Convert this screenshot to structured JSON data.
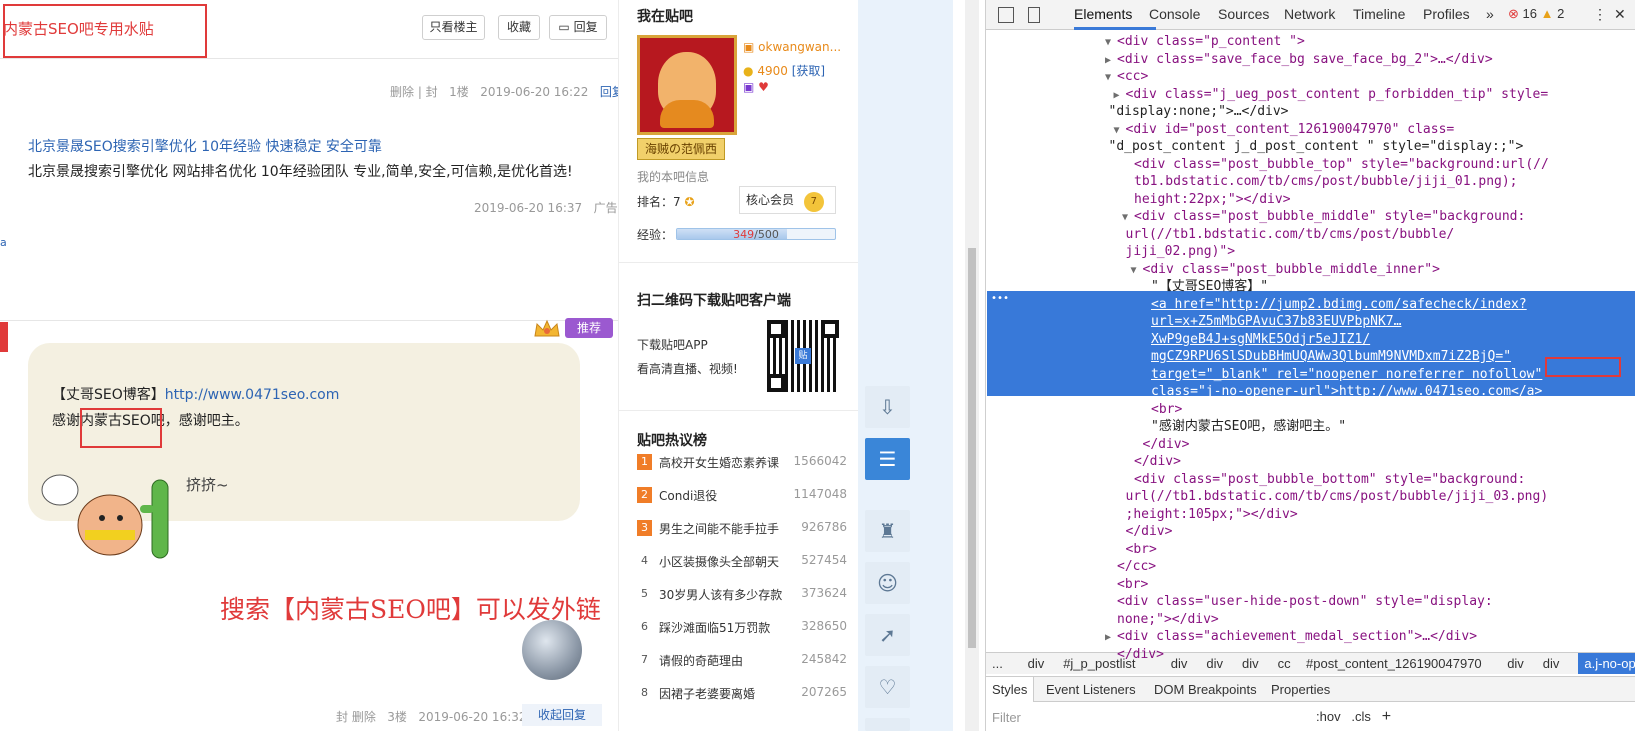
{
  "post": {
    "title": "内蒙古SEO吧专用水贴",
    "buttons": {
      "only_author": "只看楼主",
      "collect": "收藏",
      "reply": "回复"
    },
    "floor1_meta": {
      "actions": "删除 | 封",
      "floor": "1楼",
      "time": "2019-06-20 16:22",
      "reply": "回复"
    },
    "ad": {
      "title": "北京景晟SEO搜索引擎优化 10年经验 快速稳定 安全可靠",
      "desc": "北京景晟搜索引擎优化 网站排名优化 10年经验团队 专业,简单,安全,可信赖,是优化首选!",
      "time": "2019-06-20 16:37",
      "tag": "广告"
    },
    "side_char": "a",
    "recommend": "推荐",
    "bubble": {
      "line1_prefix": "【丈哥SEO博客】",
      "line1_link": "http://www.0471seo.com",
      "line2": "感谢内蒙古SEO吧，感谢吧主。"
    },
    "cartoon_text": "挤挤~",
    "big_text": "搜索【内蒙古SEO吧】可以发外链",
    "floor3_meta": {
      "actions": "封 删除",
      "floor": "3楼",
      "time": "2019-06-20 16:32",
      "collapse": "收起回复"
    }
  },
  "sidebar": {
    "in_bar_title": "我在贴吧",
    "username": "okwangwan...",
    "score": "4900",
    "get": "[获取]",
    "nick": "海贼の范佩西",
    "bar_info": "我的本吧信息",
    "rank_label": "排名：7",
    "member": "核心会员",
    "member_level": "7",
    "exp_label": "经验：",
    "exp_current": "349",
    "exp_total": "/500",
    "exp_ratio": 0.698,
    "qr_title": "扫二维码下载贴吧客户端",
    "qr_line1": "下载贴吧APP",
    "qr_line2": "看高清直播、视频!",
    "qr_mark": "贴",
    "hot_title": "贴吧热议榜",
    "hot": [
      {
        "n": "1",
        "title": "高校开女生婚恋素养课",
        "count": "1566042"
      },
      {
        "n": "2",
        "title": "Condi退役",
        "count": "1147048"
      },
      {
        "n": "3",
        "title": "男生之间能不能手拉手",
        "count": "926786"
      },
      {
        "n": "4",
        "title": "小区装摄像头全部朝天",
        "count": "527454"
      },
      {
        "n": "5",
        "title": "30岁男人该有多少存款",
        "count": "373624"
      },
      {
        "n": "6",
        "title": "踩沙滩面临51万罚款",
        "count": "328650"
      },
      {
        "n": "7",
        "title": "请假的奇葩理由",
        "count": "245842"
      },
      {
        "n": "8",
        "title": "因裙子老婆要离婚",
        "count": "207265"
      }
    ]
  },
  "devtools": {
    "tabs": [
      "Elements",
      "Console",
      "Sources",
      "Network",
      "Timeline",
      "Profiles"
    ],
    "more": "»",
    "errors": "16",
    "warnings": "2",
    "menu": "⋮",
    "close": "✕",
    "dots": "•••",
    "crumbs": [
      "...",
      "div",
      "#j_p_postlist",
      "div",
      "div",
      "div",
      "cc",
      "#post_content_126190047970",
      "div",
      "div",
      "a.j-no-opener-url"
    ],
    "style_tabs": [
      "Styles",
      "Event Listeners",
      "DOM Breakpoints",
      "Properties"
    ],
    "filter": "Filter",
    "hov": ":hov",
    "cls": ".cls",
    "plus": "+",
    "lines": [
      {
        "indent": 14,
        "tri": "▼",
        "html": "<div class=\"p_content  \">"
      },
      {
        "indent": 14,
        "tri": "▶",
        "html": "<div class=\"save_face_bg save_face_bg_2\">…</div>"
      },
      {
        "indent": 14,
        "tri": "▼",
        "html": "<cc>"
      },
      {
        "indent": 15,
        "tri": "▶",
        "html": "<div class=\"j_ueg_post_content p_forbidden_tip\" style="
      },
      {
        "indent": 13,
        "tri": "",
        "html": "\"display:none;\">…</div>"
      },
      {
        "indent": 15,
        "tri": "▼",
        "html": "<div id=\"post_content_126190047970\" class="
      },
      {
        "indent": 13,
        "tri": "",
        "html": "\"d_post_content j_d_post_content \" style=\"display:;\">"
      },
      {
        "indent": 16,
        "tri": "",
        "html": "<div class=\"post_bubble_top\" style=\"background:url(//"
      },
      {
        "indent": 16,
        "tri": "",
        "html": "tb1.bdstatic.com/tb/cms/post/bubble/jiji_01.png);"
      },
      {
        "indent": 16,
        "tri": "",
        "html": "height:22px;\"></div>"
      },
      {
        "indent": 16,
        "tri": "▼",
        "html": "<div class=\"post_bubble_middle\" style=\"background:"
      },
      {
        "indent": 15,
        "tri": "",
        "html": "url(//tb1.bdstatic.com/tb/cms/post/bubble/"
      },
      {
        "indent": 15,
        "tri": "",
        "html": "jiji_02.png)\">"
      },
      {
        "indent": 17,
        "tri": "▼",
        "html": "<div class=\"post_bubble_middle_inner\">"
      },
      {
        "indent": 18,
        "tri": "",
        "html": "\"【丈哥SEO博客】\""
      },
      {
        "indent": 18,
        "tri": "",
        "html": "<a href=\"http://jump2.bdimg.com/safecheck/index?",
        "sel": true
      },
      {
        "indent": 18,
        "tri": "",
        "html": "url=x+Z5mMbGPAvuC37b83EUVPbpNK7…",
        "sel": true
      },
      {
        "indent": 18,
        "tri": "",
        "html": "XwP9geB4J+sgNMkE5Odjr5eJIZ1/",
        "sel": true
      },
      {
        "indent": 18,
        "tri": "",
        "html": "mgCZ9RPU6SlSDubBHmUQAWw3QlbumM9NVMDxm7iZ2BjQ=\"",
        "sel": true
      },
      {
        "indent": 18,
        "tri": "",
        "html": "target=\"_blank\" rel=\"noopener noreferrer nofollow\"",
        "sel": true
      },
      {
        "indent": 18,
        "tri": "",
        "html": "class=\"j-no-opener-url\">http://www.0471seo.com</a>",
        "sel": true
      },
      {
        "indent": 18,
        "tri": "",
        "html": "<br>"
      },
      {
        "indent": 18,
        "tri": "",
        "html": "\"感谢内蒙古SEO吧，感谢吧主。\""
      },
      {
        "indent": 17,
        "tri": "",
        "html": "</div>"
      },
      {
        "indent": 16,
        "tri": "",
        "html": "</div>"
      },
      {
        "indent": 16,
        "tri": "",
        "html": "<div class=\"post_bubble_bottom\" style=\"background:"
      },
      {
        "indent": 15,
        "tri": "",
        "html": "url(//tb1.bdstatic.com/tb/cms/post/bubble/jiji_03.png)"
      },
      {
        "indent": 15,
        "tri": "",
        "html": ";height:105px;\"></div>"
      },
      {
        "indent": 15,
        "tri": "",
        "html": "</div>"
      },
      {
        "indent": 15,
        "tri": "",
        "html": "<br>"
      },
      {
        "indent": 14,
        "tri": "",
        "html": "</cc>"
      },
      {
        "indent": 14,
        "tri": "",
        "html": "<br>"
      },
      {
        "indent": 14,
        "tri": "",
        "html": "<div class=\"user-hide-post-down\" style=\"display:"
      },
      {
        "indent": 14,
        "tri": "",
        "html": "none;\"></div>"
      },
      {
        "indent": 14,
        "tri": "▶",
        "html": "<div class=\"achievement_medal_section\">…</div>"
      },
      {
        "indent": 14,
        "tri": "",
        "html": "</div>"
      }
    ]
  }
}
